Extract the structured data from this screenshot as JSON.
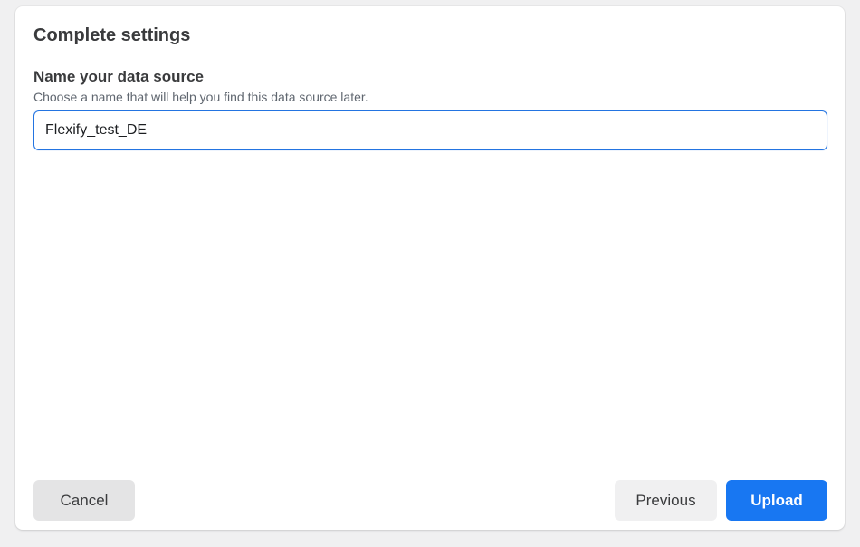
{
  "dialog": {
    "title": "Complete settings",
    "field": {
      "label": "Name your data source",
      "help_text": "Choose a name that will help you find this data source later.",
      "value": "Flexify_test_DE"
    },
    "buttons": {
      "cancel_label": "Cancel",
      "previous_label": "Previous",
      "upload_label": "Upload"
    }
  },
  "colors": {
    "primary": "#1877f2",
    "focus_border": "#2374e1",
    "page_background": "#f0f0f1"
  }
}
